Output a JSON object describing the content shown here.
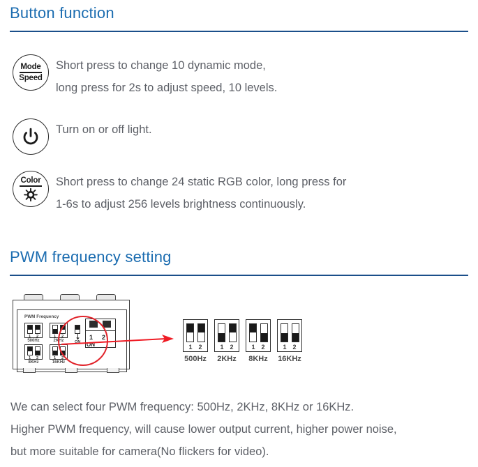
{
  "sections": {
    "button_function": {
      "title": "Button function",
      "rule_color": "#1b4f8a",
      "title_color": "#1b6cb0",
      "rows": [
        {
          "icon": "mode-speed-button-icon",
          "icon_label_top": "Mode",
          "icon_label_bottom": "Speed",
          "lines": [
            "Short press to change 10 dynamic mode,",
            "long press for 2s  to adjust speed, 10 levels."
          ]
        },
        {
          "icon": "power-button-icon",
          "icon_label_top": "",
          "icon_label_bottom": "",
          "lines": [
            "Turn on or off light."
          ]
        },
        {
          "icon": "color-brightness-button-icon",
          "icon_label_top": "Color",
          "icon_label_bottom": "sun-icon",
          "lines": [
            "Short press to change 24 static RGB color, long press for",
            "1-6s to adjust 256 levels brightness continuously."
          ]
        }
      ]
    },
    "pwm": {
      "title": "PWM frequency setting",
      "device": {
        "panel_label": "PWM Frequency",
        "on_label": "ON",
        "zoom_on_label": "ON",
        "zoom_nums": [
          "1",
          "2"
        ],
        "switches": [
          {
            "caption": "500Hz",
            "nums": [
              "1",
              "2"
            ],
            "positions": [
              "up",
              "up"
            ]
          },
          {
            "caption": "2KHz",
            "nums": [
              "1",
              "2"
            ],
            "positions": [
              "down",
              "up"
            ]
          },
          {
            "caption": "8KHz",
            "nums": [
              "1",
              "2"
            ],
            "positions": [
              "up",
              "down"
            ]
          },
          {
            "caption": "16KHz",
            "nums": [
              "1",
              "2"
            ],
            "positions": [
              "down",
              "down"
            ]
          }
        ]
      },
      "detail_switches": [
        {
          "caption": "500Hz",
          "nums": [
            "1",
            "2"
          ],
          "positions": [
            "up",
            "up"
          ]
        },
        {
          "caption": "2KHz",
          "nums": [
            "1",
            "2"
          ],
          "positions": [
            "down",
            "up"
          ]
        },
        {
          "caption": "8KHz",
          "nums": [
            "1",
            "2"
          ],
          "positions": [
            "up",
            "down"
          ]
        },
        {
          "caption": "16KHz",
          "nums": [
            "1",
            "2"
          ],
          "positions": [
            "down",
            "down"
          ]
        }
      ],
      "callout_color": "#e1232a",
      "paragraph": [
        "We can select four PWM frequency: 500Hz, 2KHz, 8KHz or 16KHz.",
        "Higher PWM frequency, will cause lower output current, higher power noise,",
        "but more suitable for camera(No flickers for video)."
      ]
    }
  }
}
